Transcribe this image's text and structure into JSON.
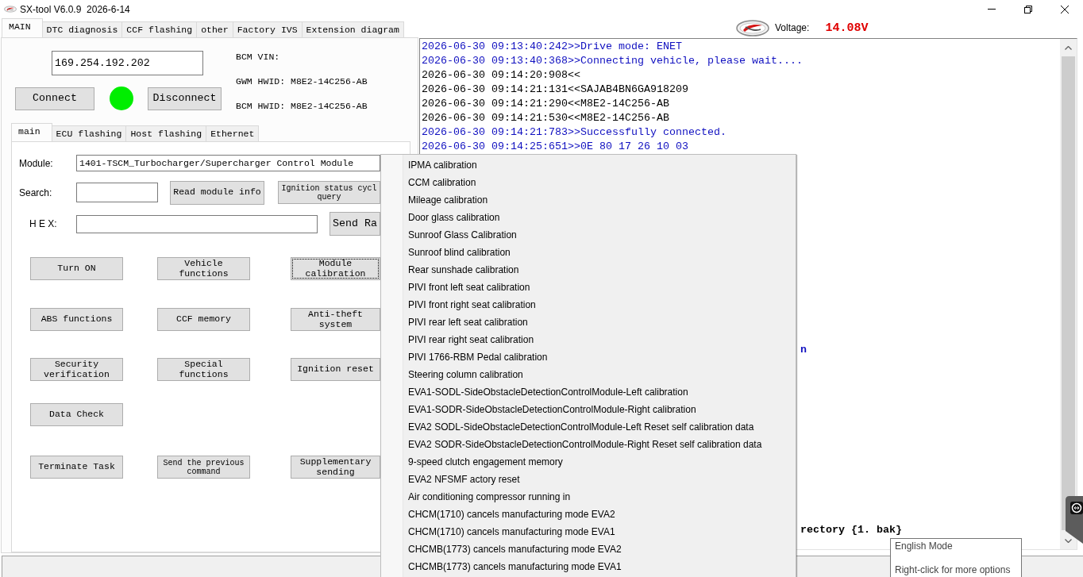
{
  "window": {
    "title": "SX-tool V6.0.9  2026-6-14"
  },
  "main_tabs": [
    {
      "label": "MAIN",
      "selected": true
    },
    {
      "label": "DTC diagnosis",
      "selected": false
    },
    {
      "label": "CCF flashing",
      "selected": false
    },
    {
      "label": "other",
      "selected": false
    },
    {
      "label": "Factory IVS",
      "selected": false
    },
    {
      "label": "Extension diagram",
      "selected": false
    }
  ],
  "voltage": {
    "label": "Voltage:",
    "value": "14.08V"
  },
  "connection": {
    "address": "169.254.192.202",
    "connect_button": "Connect",
    "connected": true,
    "disconnect_button": "Disconnect",
    "info": [
      "BCM VIN:",
      "GWM HWID: M8E2-14C256-AB",
      "BCM HWID: M8E2-14C256-AB"
    ]
  },
  "sub_tabs": [
    {
      "label": "main",
      "selected": true
    },
    {
      "label": "ECU flashing",
      "selected": false
    },
    {
      "label": "Host flashing",
      "selected": false
    },
    {
      "label": "Ethernet",
      "selected": false
    }
  ],
  "module": {
    "label": "Module:",
    "value": "1401-TSCM_Turbocharger/Supercharger Control Module"
  },
  "search": {
    "label": "Search:",
    "read_button": "Read module info",
    "ignition_button": "Ignition status cycl\nquery"
  },
  "hex": {
    "label": "H E X:",
    "send_button": "Send Ra"
  },
  "function_rows": [
    [
      {
        "label": "Turn ON",
        "focused": false
      },
      {
        "label": "Vehicle functions",
        "focused": false
      },
      {
        "label": "Module calibration",
        "focused": true
      }
    ],
    [
      {
        "label": "ABS functions",
        "focused": false
      },
      {
        "label": "CCF memory",
        "focused": false
      },
      {
        "label": "Anti-theft system",
        "focused": false
      }
    ],
    [
      {
        "label": "Security verification",
        "focused": false
      },
      {
        "label": "Special functions",
        "focused": false
      },
      {
        "label": "Ignition reset",
        "focused": false
      }
    ],
    [
      {
        "label": "Data Check",
        "focused": false
      }
    ],
    [
      {
        "label": "Terminate Task",
        "focused": false
      },
      {
        "label": "Send the previous command",
        "focused": false
      },
      {
        "label": "Supplementary sending",
        "focused": false
      }
    ]
  ],
  "log": {
    "lines": [
      {
        "text": "2026-06-30 09:13:40:242>>Drive mode: ENET",
        "color": "#1010c0"
      },
      {
        "text": "2026-06-30 09:13:40:368>>Connecting vehicle, please wait....",
        "color": "#1010c0"
      },
      {
        "text": "2026-06-30 09:14:20:908<<",
        "color": "#000000"
      },
      {
        "text": "2026-06-30 09:14:21:131<<SAJAB4BN6GA918209",
        "color": "#000000"
      },
      {
        "text": "2026-06-30 09:14:21:290<<M8E2-14C256-AB",
        "color": "#000000"
      },
      {
        "text": "2026-06-30 09:14:21:530<<M8E2-14C256-AB",
        "color": "#000000"
      },
      {
        "text": "2026-06-30 09:14:21:783>>Successfully connected.",
        "color": "#1010c0"
      },
      {
        "text": "2026-06-30 09:14:25:651>>0E 80 17 26 10 03",
        "color": "#1010c0"
      }
    ],
    "tails": [
      {
        "text": "n",
        "color": "#1010c0"
      },
      {
        "text": "rectory {1. bak}",
        "color": "#000000"
      }
    ]
  },
  "context_menu": {
    "items": [
      "IPMA calibration",
      "CCM calibration",
      "Mileage calibration",
      "Door glass calibration",
      "Sunroof Glass Calibration",
      "Sunroof blind calibration",
      "Rear sunshade calibration",
      "PIVI front left seat calibration",
      "PIVI front right seat calibration",
      "PIVI rear left seat calibration",
      "PIVI rear right seat calibration",
      "PIVI 1766-RBM Pedal calibration",
      "Steering column calibration",
      "EVA1-SODL-SideObstacleDetectionControlModule-Left calibration",
      "EVA1-SODR-SideObstacleDetectionControlModule-Right calibration",
      "EVA2 SODL-SideObstacleDetectionControlModule-Left Reset self calibration data",
      "EVA2 SODR-SideObstacleDetectionControlModule-Right Reset self calibration data",
      "9-speed clutch engagement memory",
      "EVA2 NFSMF actory reset",
      "Air conditioning compressor running in",
      "CHCM(1710) cancels manufacturing mode EVA2",
      "CHCM(1710) cancels manufacturing mode EVA1",
      "CHCMB(1773) cancels manufacturing mode EVA2",
      "CHCMB(1773) cancels manufacturing mode EVA1"
    ]
  },
  "tooltip": {
    "lines": [
      "English Mode",
      "Right-click for more options"
    ]
  }
}
